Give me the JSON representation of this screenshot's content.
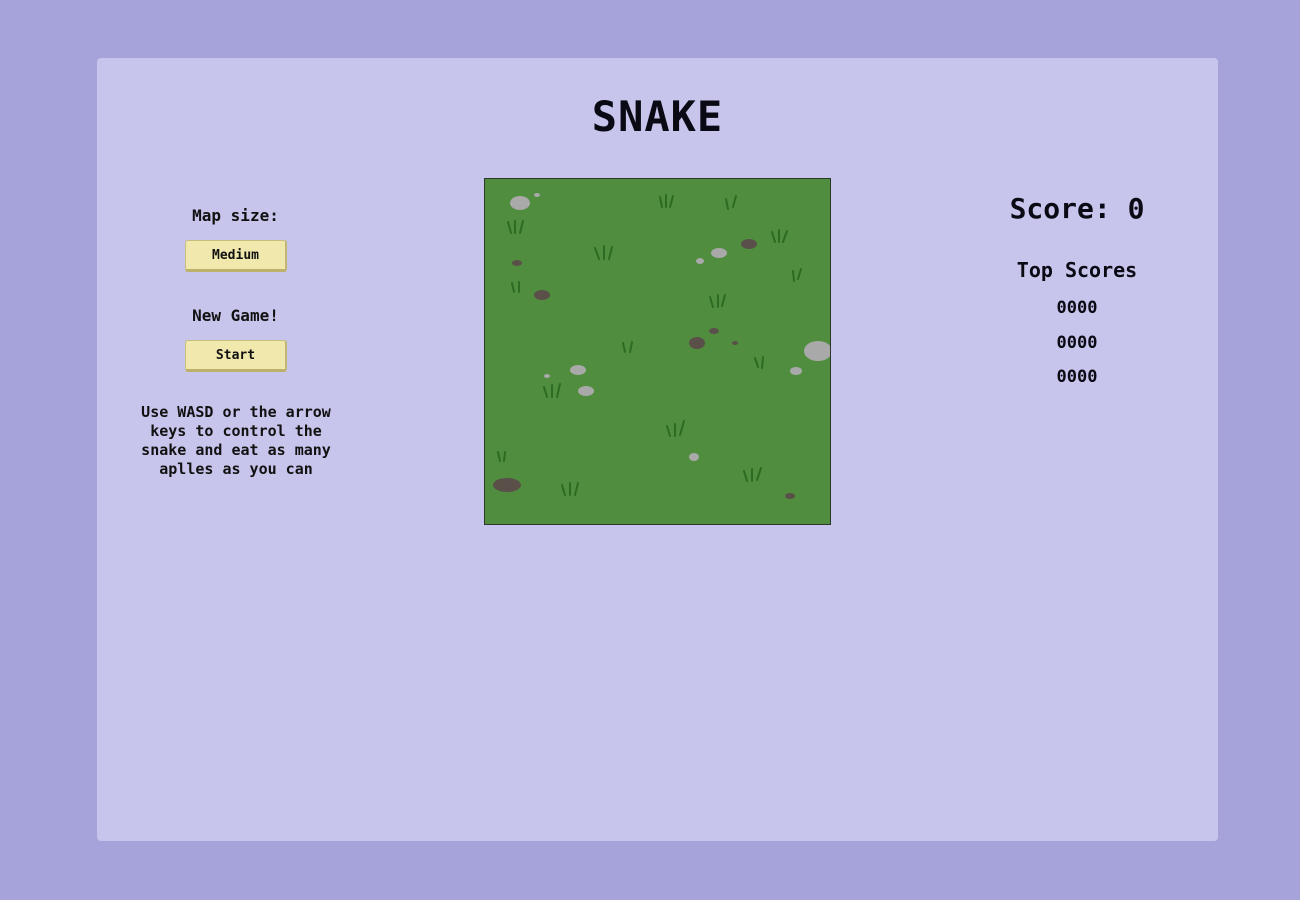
{
  "title": "SNAKE",
  "controls": {
    "map_size_label": "Map size:",
    "map_size_button": "Medium",
    "new_game_label": "New Game!",
    "start_button": "Start",
    "instructions": "Use WASD or the arrow keys to control the snake and eat as many aplles as you can"
  },
  "scoreboard": {
    "score_text": "Score: 0",
    "top_scores_title": "Top Scores",
    "top_scores": [
      "0000",
      "0000",
      "0000"
    ]
  },
  "board": {
    "grass_color": "#508d3e",
    "tuft_color": "#2d6b22",
    "stone_light": "#a9a9a9",
    "stone_dark": "#5b4f4a"
  },
  "colors": {
    "page_bg": "#a6a2da",
    "panel_bg": "#c7c5ec",
    "button_bg": "#f0e8ad"
  }
}
